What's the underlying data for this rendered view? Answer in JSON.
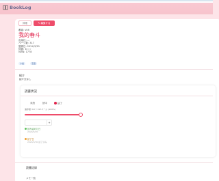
{
  "app": {
    "title": "BookLog"
  },
  "tabs": [
    {
      "label": "詳細"
    },
    {
      "label": "✎ 編集する"
    }
  ],
  "book": {
    "author_line": "著者: vhlt",
    "title": "我的春斗",
    "meta": [
      "出版社: —",
      "ページ数: 317",
      "登録日: 2024/3/30",
      "評価: ★☆☆",
      "ISBN: 1778"
    ],
    "tags": [
      "小説",
      "恋愛"
    ]
  },
  "intro": {
    "label": "紹介",
    "text": "紹介文なし"
  },
  "progress": {
    "title": "読書状況",
    "radio_options": [
      {
        "label": "未読",
        "selected": false
      },
      {
        "label": "読中",
        "selected": false
      },
      {
        "label": "読了",
        "selected": true
      }
    ],
    "slider_label": "進捗度 317 / 317ページ (100%)",
    "progress_fraction": 1.0,
    "stepper_value": "",
    "stepper_button": "+",
    "status_items": [
      {
        "label": "読み始めた日",
        "sub": "2024/3/20",
        "color": "#5ec35e"
      },
      {
        "label": "読了日",
        "sub": "2024/3/30 読了済み",
        "color": "#f0a030"
      }
    ]
  },
  "notes": {
    "label": "読書記録",
    "sub": "メモ一覧"
  },
  "colors": {
    "accent": "#ee4c6a",
    "background": "#fde4e8"
  }
}
